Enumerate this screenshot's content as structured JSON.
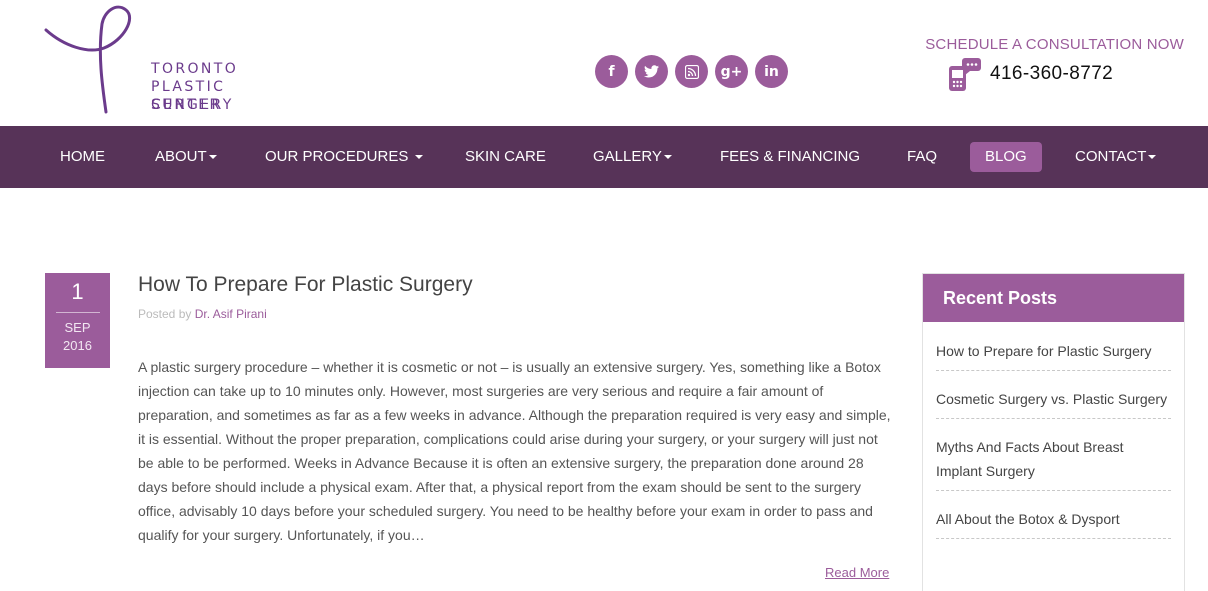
{
  "brand": {
    "line1": "TORONTO",
    "line2": "PLASTIC SURGERY",
    "line3": "CENTER"
  },
  "social": [
    {
      "icon": "facebook-icon",
      "glyph": "f"
    },
    {
      "icon": "twitter-icon",
      "glyph": "t"
    },
    {
      "icon": "rss-icon",
      "glyph": "rss"
    },
    {
      "icon": "google-plus-icon",
      "glyph": "g+"
    },
    {
      "icon": "linkedin-icon",
      "glyph": "in"
    }
  ],
  "contact": {
    "cta": "SCHEDULE A CONSULTATION NOW",
    "phone": "416-360-8772"
  },
  "nav": {
    "items": [
      {
        "label": "HOME",
        "dropdown": false
      },
      {
        "label": "ABOUT",
        "dropdown": true
      },
      {
        "label": "OUR PROCEDURES ",
        "dropdown": true
      },
      {
        "label": "SKIN CARE",
        "dropdown": false
      },
      {
        "label": "GALLERY",
        "dropdown": true
      },
      {
        "label": "FEES & FINANCING",
        "dropdown": false
      },
      {
        "label": "FAQ",
        "dropdown": false
      },
      {
        "label": "BLOG",
        "dropdown": false,
        "active": true
      },
      {
        "label": "CONTACT",
        "dropdown": true
      }
    ]
  },
  "post": {
    "date": {
      "day": "1",
      "month": "SEP",
      "year": "2016"
    },
    "title": "How To Prepare For Plastic Surgery",
    "posted_by": "Posted by",
    "author": "Dr. Asif Pirani",
    "excerpt": "A plastic surgery procedure – whether it is cosmetic or not – is usually an extensive surgery. Yes, something like a Botox injection can take up to 10 minutes only. However, most surgeries are very serious and require a fair amount of preparation, and sometimes as far as a few weeks in advance. Although the preparation required is very easy and simple, it is essential. Without the proper preparation, complications could arise during your surgery, or your surgery will just not be able to be performed. Weeks in Advance Because it is often an extensive surgery, the preparation done around 28 days before should include a physical exam. After that, a physical report from the exam should be sent to the surgery office, advisably 10 days before your scheduled surgery. You need to be healthy before your exam in order to pass and qualify for your surgery. Unfortunately, if you…",
    "read_more": "Read More"
  },
  "sidebar": {
    "heading": "Recent Posts",
    "items": [
      "How to Prepare for Plastic Surgery",
      "Cosmetic Surgery vs. Plastic Surgery",
      "Myths And Facts About Breast Implant Surgery",
      "All About the Botox & Dysport"
    ]
  },
  "colors": {
    "brand_purple": "#9b5c9b",
    "nav_background": "#573358",
    "logo_purple": "#6b3b8c"
  }
}
